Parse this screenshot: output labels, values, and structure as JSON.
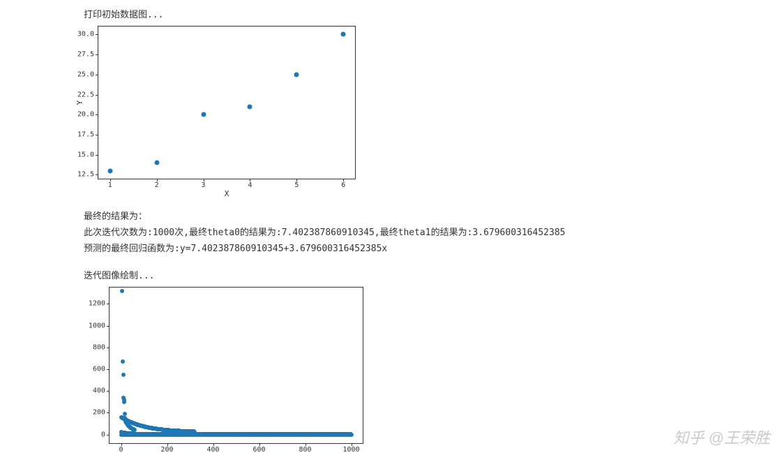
{
  "texts": {
    "line1": "打印初始数据图...",
    "line2": "最终的结果为：",
    "line3": "此次迭代次数为:1000次,最终theta0的结果为:7.402387860910345,最终theta1的结果为:3.679600316452385",
    "line4": "预测的最终回归函数为:y=7.402387860910345+3.679600316452385x",
    "line5": "迭代图像绘制..."
  },
  "watermark": "知乎 @王荣胜",
  "chart_data": [
    {
      "type": "scatter",
      "title": "",
      "xlabel": "X",
      "ylabel": "Y",
      "x": [
        1,
        2,
        3,
        4,
        5,
        6
      ],
      "y": [
        13,
        14,
        20,
        21,
        25,
        30
      ],
      "xlim": [
        0.75,
        6.25
      ],
      "ylim": [
        12,
        31
      ],
      "xticks": [
        1,
        2,
        3,
        4,
        5,
        6
      ],
      "yticks": [
        12.5,
        15.0,
        17.5,
        20.0,
        22.5,
        25.0,
        27.5,
        30.0
      ]
    },
    {
      "type": "scatter",
      "title": "",
      "xlabel": "",
      "ylabel": "",
      "description": "Cost J vs iteration; rapid exponential-like decay toward 0",
      "xlim": [
        -50,
        1050
      ],
      "ylim": [
        -80,
        1350
      ],
      "xticks": [
        0,
        200,
        400,
        600,
        800,
        1000
      ],
      "yticks": [
        0,
        200,
        400,
        600,
        800,
        1000,
        1200
      ]
    }
  ]
}
